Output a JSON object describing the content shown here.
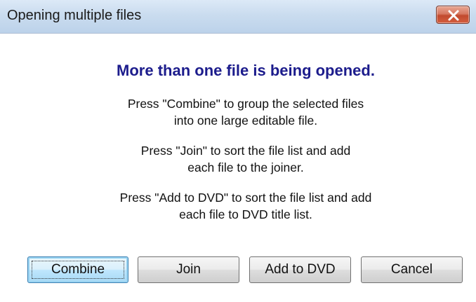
{
  "window": {
    "title": "Opening multiple files",
    "close_icon": "close-icon"
  },
  "message": {
    "heading": "More than one file is being opened.",
    "combine_line1": "Press \"Combine\" to group the selected files",
    "combine_line2": "into one large editable file.",
    "join_line1": "Press \"Join\" to sort the file list and add",
    "join_line2": "each file to the joiner.",
    "dvd_line1": "Press \"Add to DVD\" to sort the file list and add",
    "dvd_line2": "each file to DVD title list."
  },
  "buttons": {
    "combine": "Combine",
    "join": "Join",
    "add_to_dvd": "Add to DVD",
    "cancel": "Cancel"
  },
  "colors": {
    "heading": "#1c1c8c",
    "close_button": "#c14a2e",
    "default_button_border": "#3c7fb1"
  }
}
